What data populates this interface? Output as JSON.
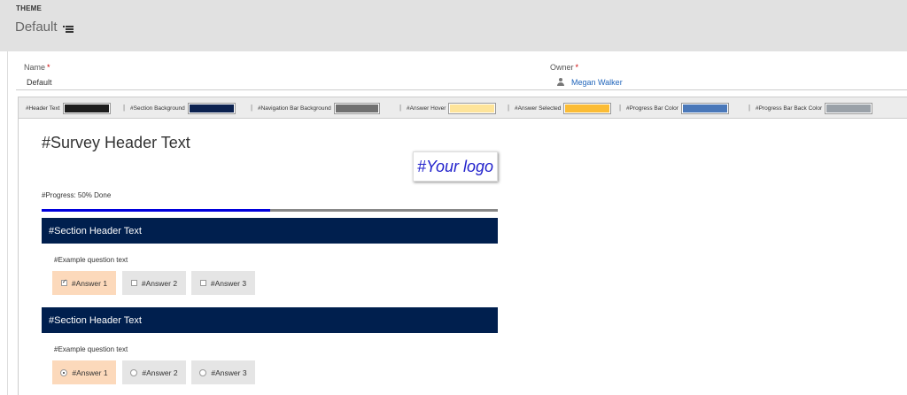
{
  "header": {
    "entity_label": "THEME",
    "record_title": "Default",
    "list_icon": "list-icon"
  },
  "fields": {
    "name_label": "Name",
    "name_required": "*",
    "name_value": "Default",
    "owner_label": "Owner",
    "owner_required": "*",
    "owner_value": "Megan Walker",
    "owner_icon": "user-icon"
  },
  "color_bar": {
    "separator": "|",
    "items": [
      {
        "label": "#Header Text",
        "color": "#1e1e1e"
      },
      {
        "label": "#Section Background",
        "color": "#0c2250"
      },
      {
        "label": "#Navigation Bar Background",
        "color": "#707070"
      },
      {
        "label": "#Answer Hover",
        "color": "#fee49a"
      },
      {
        "label": "#Answer Selected",
        "color": "#fbbc35"
      },
      {
        "label": "#Progress Bar Color",
        "color": "#4a78b9"
      },
      {
        "label": "#Progress Bar Back Color",
        "color": "#9aa1a8"
      }
    ]
  },
  "survey": {
    "title": "#Survey Header Text",
    "logo_text": "#Your logo",
    "progress_label": "#Progress: 50% Done",
    "progress_value": 0.5,
    "progress_color": "#0000dd",
    "progress_back_color": "#888888",
    "section_color": "#001f4e",
    "answer_selected_color": "#fcd9bb",
    "answer_color": "#e5e5e5",
    "sections": [
      {
        "header": "#Section Header Text",
        "question": "#Example question text",
        "control": "checkbox",
        "answers": [
          {
            "label": "#Answer 1",
            "selected": true
          },
          {
            "label": "#Answer 2",
            "selected": false
          },
          {
            "label": "#Answer 3",
            "selected": false
          }
        ]
      },
      {
        "header": "#Section Header Text",
        "question": "#Example question text",
        "control": "radio",
        "answers": [
          {
            "label": "#Answer 1",
            "selected": true
          },
          {
            "label": "#Answer 2",
            "selected": false
          },
          {
            "label": "#Answer 3",
            "selected": false
          }
        ]
      }
    ]
  }
}
